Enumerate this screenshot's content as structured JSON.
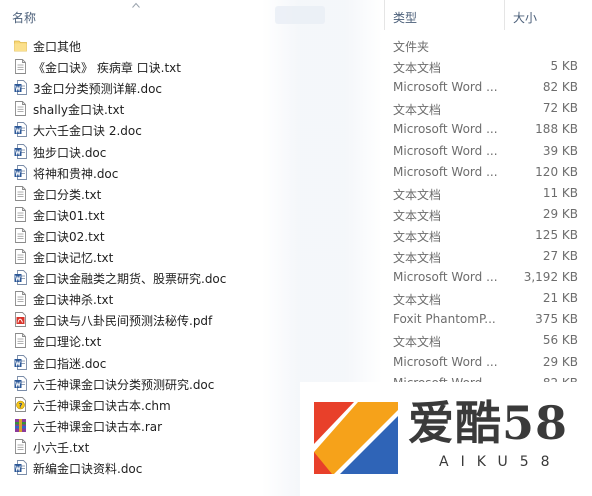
{
  "columns": {
    "name": "名称",
    "type": "类型",
    "size": "大小"
  },
  "files": [
    {
      "name": "金口其他",
      "type": "文件夹",
      "size": "",
      "icon": "folder-icon"
    },
    {
      "name": "《金口诀》 疾病章 口诀.txt",
      "type": "文本文档",
      "size": "5 KB",
      "icon": "txt-file-icon"
    },
    {
      "name": "3金口分类预测详解.doc",
      "type": "Microsoft Word ...",
      "size": "82 KB",
      "icon": "word-doc-icon"
    },
    {
      "name": "shally金口诀.txt",
      "type": "文本文档",
      "size": "72 KB",
      "icon": "txt-file-icon"
    },
    {
      "name": "大六壬金口诀 2.doc",
      "type": "Microsoft Word ...",
      "size": "188 KB",
      "icon": "word-doc-icon"
    },
    {
      "name": "独步口诀.doc",
      "type": "Microsoft Word ...",
      "size": "39 KB",
      "icon": "word-doc-icon"
    },
    {
      "name": "将神和贵神.doc",
      "type": "Microsoft Word ...",
      "size": "120 KB",
      "icon": "word-doc-icon"
    },
    {
      "name": "金口分类.txt",
      "type": "文本文档",
      "size": "11 KB",
      "icon": "txt-file-icon"
    },
    {
      "name": "金口诀01.txt",
      "type": "文本文档",
      "size": "29 KB",
      "icon": "txt-file-icon"
    },
    {
      "name": "金口诀02.txt",
      "type": "文本文档",
      "size": "125 KB",
      "icon": "txt-file-icon"
    },
    {
      "name": "金口诀记忆.txt",
      "type": "文本文档",
      "size": "27 KB",
      "icon": "txt-file-icon"
    },
    {
      "name": "金口诀金融类之期货、股票研究.doc",
      "type": "Microsoft Word ...",
      "size": "3,192 KB",
      "icon": "word-doc-icon"
    },
    {
      "name": "金口诀神杀.txt",
      "type": "文本文档",
      "size": "21 KB",
      "icon": "txt-file-icon"
    },
    {
      "name": "金口诀与八卦民间预测法秘传.pdf",
      "type": "Foxit PhantomP...",
      "size": "375 KB",
      "icon": "pdf-file-icon"
    },
    {
      "name": "金口理论.txt",
      "type": "文本文档",
      "size": "56 KB",
      "icon": "txt-file-icon"
    },
    {
      "name": "金口指迷.doc",
      "type": "Microsoft Word ...",
      "size": "29 KB",
      "icon": "word-doc-icon"
    },
    {
      "name": "六壬神课金口诀分类预测研究.doc",
      "type": "Microsoft Word ...",
      "size": "82 KB",
      "icon": "word-doc-icon"
    },
    {
      "name": "六壬神课金口诀古本.chm",
      "type": "",
      "size": "",
      "icon": "chm-help-icon"
    },
    {
      "name": "六壬神课金口诀古本.rar",
      "type": "",
      "size": "",
      "icon": "rar-archive-icon"
    },
    {
      "name": "小六壬.txt",
      "type": "",
      "size": "",
      "icon": "txt-file-icon"
    },
    {
      "name": "新编金口诀资料.doc",
      "type": "",
      "size": "",
      "icon": "word-doc-icon"
    }
  ],
  "watermark": {
    "title": "爱酷58",
    "subtitle": "AIKU58"
  }
}
